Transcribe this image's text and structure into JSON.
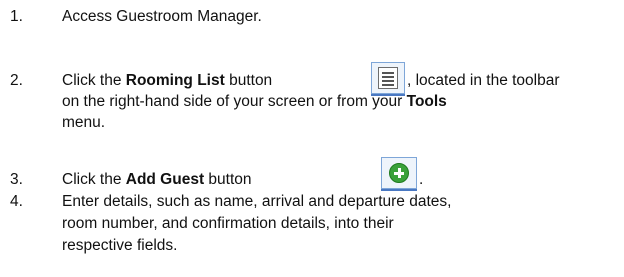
{
  "steps": [
    {
      "number": "1.",
      "text": "Access Guestroom Manager."
    },
    {
      "number": "2.",
      "pre": "Click the ",
      "bold1": "Rooming List",
      "mid": " button",
      "post": ", located in the toolbar",
      "line2": "on the right-hand side of your screen or from your ",
      "bold2": "Tools",
      "line3": "menu.",
      "icon": "rooming-list-icon"
    },
    {
      "number": "3.",
      "pre": "Click the ",
      "bold1": "Add Guest",
      "mid": " button",
      "post": ".",
      "icon": "add-guest-icon",
      "icon_color": "#3aa13a"
    },
    {
      "number": "4.",
      "line1": "Enter details, such as name, arrival and departure dates,",
      "line2": "room number, and confirmation details, into their",
      "line3": "respective fields."
    }
  ]
}
